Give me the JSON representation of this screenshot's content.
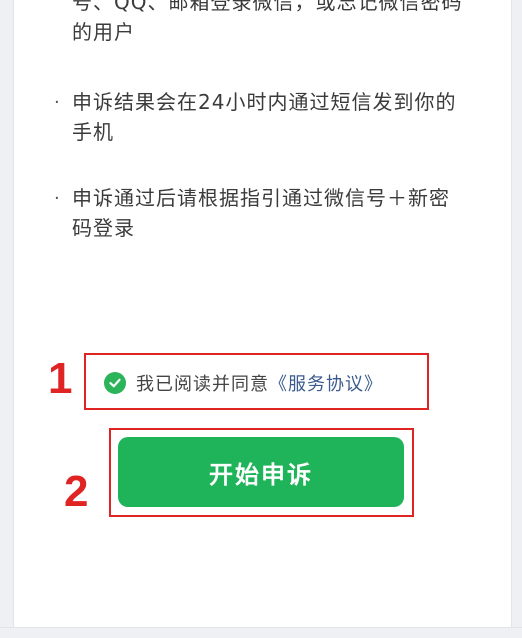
{
  "content": {
    "top_partial_line": "号、QQ、邮箱登录微信，或忘记微信密码",
    "top_line2": "的用户",
    "bullet_symbol": "·",
    "item2_line1": "申诉结果会在24小时内通过短信发到你的",
    "item2_line2": "手机",
    "item3_line1": "申诉通过后请根据指引通过微信号＋新密",
    "item3_line2": "码登录"
  },
  "agreement": {
    "text": "我已阅读并同意",
    "link": "《服务协议》",
    "checked": true
  },
  "start_button_label": "开始申诉",
  "annotations": {
    "num1": "1",
    "num2": "2"
  },
  "colors": {
    "accent_green": "#1fb45a",
    "annotation_red": "#e02424"
  }
}
